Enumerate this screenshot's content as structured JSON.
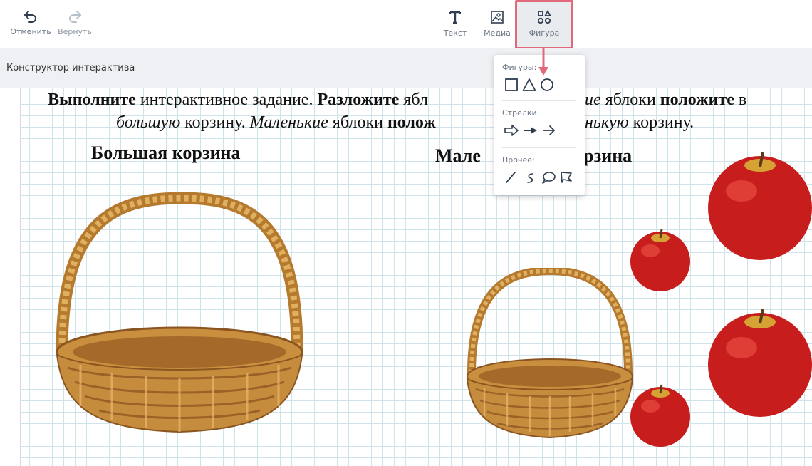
{
  "toolbar": {
    "undo_label": "Отменить",
    "redo_label": "Вернуть",
    "text_label": "Текст",
    "media_label": "Медиа",
    "shape_label": "Фигура"
  },
  "subbar": {
    "title": "Конструктор интерактива"
  },
  "task": {
    "t1": "Выполните",
    "t2": " интерактивное задание. ",
    "t3": "Разложите",
    "t4": " ябл",
    "t5": "ие",
    "t6": " яблоки ",
    "t7": "положите",
    "t8": " в",
    "t9": "большую",
    "t10": " корзину. ",
    "t11": "Маленькие",
    "t12": " яблоки ",
    "t13": "полож",
    "t14": "нькую",
    "t15": " корзину."
  },
  "headers": {
    "big_basket": "Большая корзина",
    "small_basket_left": "Мале",
    "small_basket_right": "рзина"
  },
  "dropdown": {
    "shapes_label": "Фигуры:",
    "arrows_label": "Стрелки:",
    "other_label": "Прочее:"
  },
  "colors": {
    "highlight": "#e06a79",
    "grid": "#cfe3ea",
    "icon": "#2e3d4f"
  }
}
